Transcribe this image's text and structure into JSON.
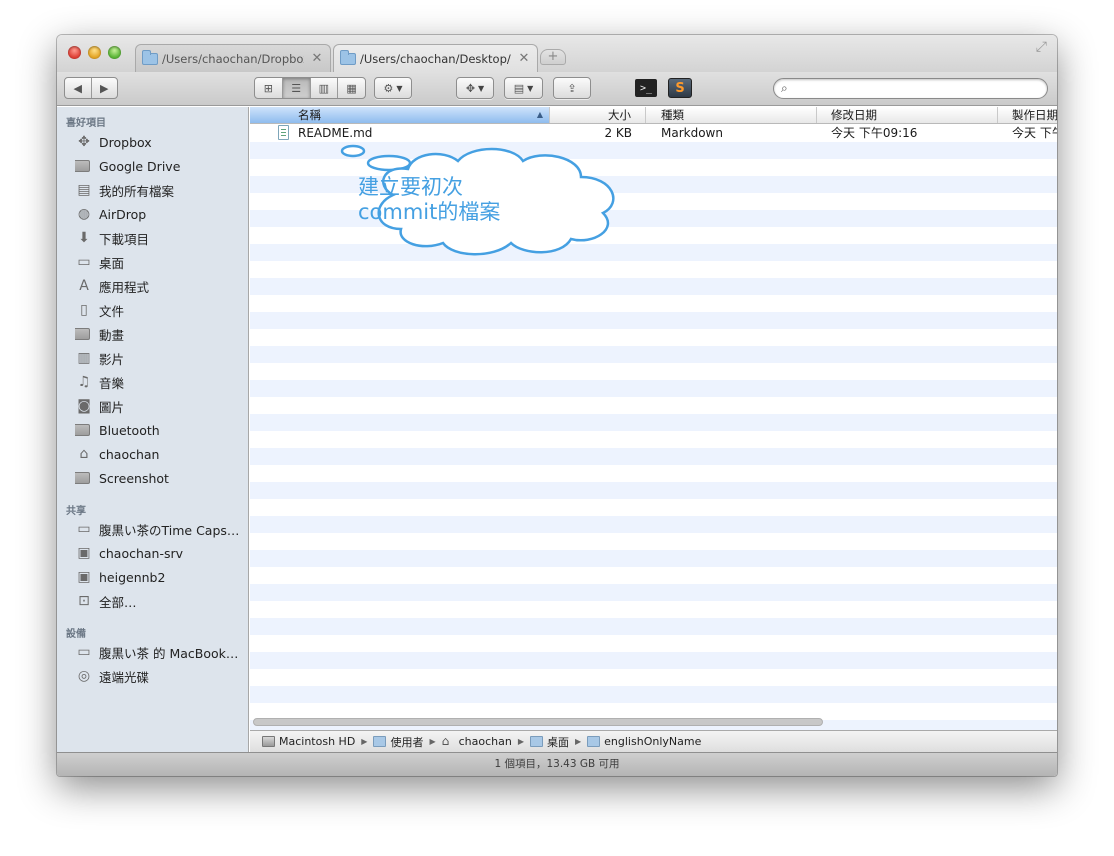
{
  "tabs": [
    {
      "label": "/Users/chaochan/Dropbox/",
      "close": "✕"
    },
    {
      "label": "/Users/chaochan/Desktop/",
      "close": "✕"
    }
  ],
  "new_tab_symbol": "+",
  "toolbar": {
    "back_symbol": "◀",
    "forward_symbol": "▶",
    "view_modes": [
      "icon-view",
      "list-view",
      "column-view",
      "coverflow-view"
    ],
    "active_view": "list-view",
    "search_placeholder": ""
  },
  "sidebar": {
    "favorites_header": "喜好項目",
    "favorites": [
      {
        "label": "Dropbox",
        "icon": "dropbox-icon"
      },
      {
        "label": "Google Drive",
        "icon": "folder-icon"
      },
      {
        "label": "我的所有檔案",
        "icon": "all-files-icon"
      },
      {
        "label": "AirDrop",
        "icon": "airdrop-icon"
      },
      {
        "label": "下載項目",
        "icon": "downloads-icon"
      },
      {
        "label": "桌面",
        "icon": "desktop-icon"
      },
      {
        "label": "應用程式",
        "icon": "applications-icon"
      },
      {
        "label": "文件",
        "icon": "documents-icon"
      },
      {
        "label": "動畫",
        "icon": "folder-icon"
      },
      {
        "label": "影片",
        "icon": "movies-icon"
      },
      {
        "label": "音樂",
        "icon": "music-icon"
      },
      {
        "label": "圖片",
        "icon": "pictures-icon"
      },
      {
        "label": "Bluetooth",
        "icon": "folder-icon"
      },
      {
        "label": "chaochan",
        "icon": "home-icon"
      },
      {
        "label": "Screenshot",
        "icon": "folder-icon"
      }
    ],
    "shared_header": "共享",
    "shared": [
      {
        "label": "腹黒い茶のTime Caps…",
        "icon": "time-capsule-icon"
      },
      {
        "label": "chaochan-srv",
        "icon": "monitor-icon"
      },
      {
        "label": "heigennb2",
        "icon": "monitor-icon"
      },
      {
        "label": "全部…",
        "icon": "network-icon"
      }
    ],
    "devices_header": "設備",
    "devices": [
      {
        "label": "腹黒い茶 的 MacBook…",
        "icon": "laptop-icon"
      },
      {
        "label": "遠端光碟",
        "icon": "remote-disc-icon"
      }
    ]
  },
  "columns": {
    "name": "名稱",
    "size": "大小",
    "kind": "種類",
    "modified": "修改日期",
    "created": "製作日期"
  },
  "files": [
    {
      "name": "README.md",
      "size": "2 KB",
      "kind": "Markdown",
      "modified": "今天 下午09:16",
      "created": "今天 下午"
    }
  ],
  "annotation": {
    "line1": "建立要初次",
    "line2": "commit的檔案",
    "color": "#45a0e2"
  },
  "path": [
    {
      "label": "Macintosh HD",
      "icon": "hard-drive-icon"
    },
    {
      "label": "使用者",
      "icon": "folder-icon"
    },
    {
      "label": "chaochan",
      "icon": "home-icon"
    },
    {
      "label": "桌面",
      "icon": "folder-icon"
    },
    {
      "label": "englishOnlyName",
      "icon": "folder-icon"
    }
  ],
  "status": "1 個項目，13.43 GB 可用"
}
